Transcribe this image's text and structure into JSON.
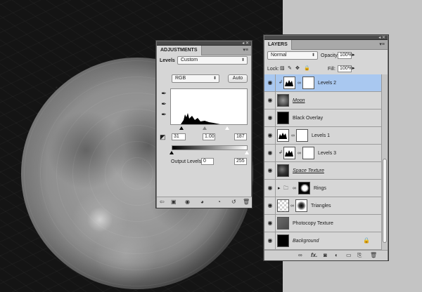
{
  "adjustments": {
    "tab_label": "ADJUSTMENTS",
    "type_label": "Levels",
    "preset_value": "Custom",
    "channel_value": "RGB",
    "auto_label": "Auto",
    "input_black": "31",
    "input_gamma": "1.00",
    "input_white": "187",
    "output_label": "Output Levels:",
    "output_black": "0",
    "output_white": "255"
  },
  "layers_panel": {
    "tab_label": "LAYERS",
    "blend_mode": "Normal",
    "opacity_label": "Opacity:",
    "opacity_value": "100%",
    "lock_label": "Lock:",
    "fill_label": "Fill:",
    "fill_value": "100%",
    "layers": [
      {
        "name": "Levels 2",
        "kind": "adjustment",
        "clipped": true,
        "selected": true
      },
      {
        "name": "Moon",
        "kind": "pixel"
      },
      {
        "name": "Black Overlay",
        "kind": "pixel"
      },
      {
        "name": "Levels 1",
        "kind": "adjustment"
      },
      {
        "name": "Levels 3",
        "kind": "adjustment",
        "clipped": true
      },
      {
        "name": "Space Texture",
        "kind": "pixel"
      },
      {
        "name": "Rings",
        "kind": "group"
      },
      {
        "name": "Triangles",
        "kind": "pixel"
      },
      {
        "name": "Photocopy Texture",
        "kind": "pixel"
      },
      {
        "name": "Background",
        "kind": "background",
        "locked": true
      }
    ]
  },
  "icons": {
    "eye": "eye-icon",
    "chain": "link-icon",
    "lock": "lock-icon",
    "folder": "folder-icon",
    "eyedropper": "eyedropper-icon"
  },
  "colors": {
    "selected_layer": "#a9c8f0",
    "panel_bg": "#d6d6d6"
  }
}
